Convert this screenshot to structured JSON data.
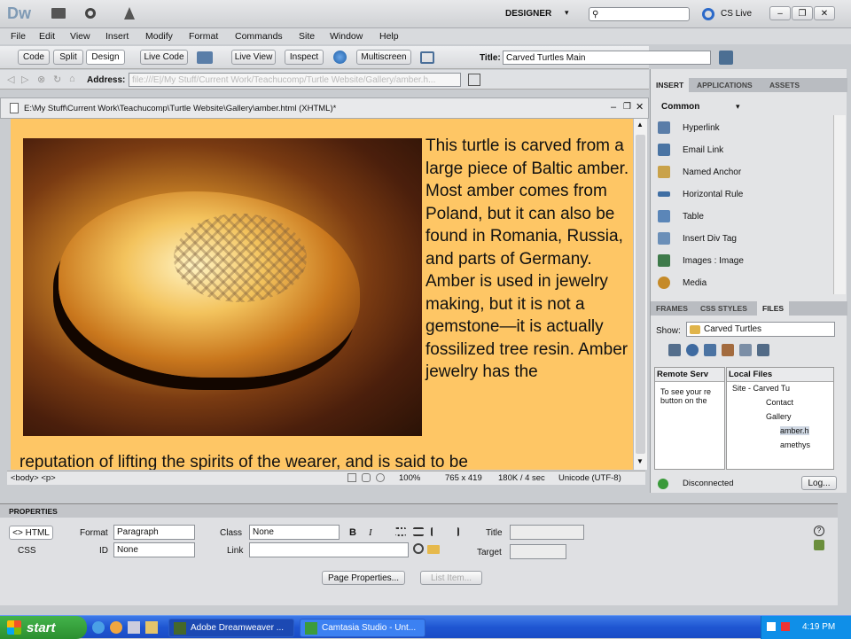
{
  "app": {
    "logo": "Dw",
    "workspace": "DESIGNER",
    "search_placeholder": "",
    "cs_live": "CS Live"
  },
  "menu": [
    "File",
    "Edit",
    "View",
    "Insert",
    "Modify",
    "Format",
    "Commands",
    "Site",
    "Window",
    "Help"
  ],
  "doc_toolbar": {
    "code": "Code",
    "split": "Split",
    "design": "Design",
    "live_code": "Live Code",
    "live_view": "Live View",
    "inspect": "Inspect",
    "multiscreen": "Multiscreen",
    "title_label": "Title:",
    "title_value": "Carved Turtles Main"
  },
  "browser_nav": {
    "address_label": "Address:",
    "address_value": "file:///E|/My Stuff/Current Work/Teachucomp/Turtle Website/Gallery/amber.h..."
  },
  "document": {
    "path": "E:\\My Stuff\\Current Work\\Teachucomp\\Turtle Website\\Gallery\\amber.html (XHTML)*",
    "text_column": "This turtle is carved from a large piece of Baltic amber.  Most amber comes from Poland, but it can also be found in Romania, Russia, and parts of Germany. Amber is used in jewelry making, but it is not a gemstone—it is actually fossilized tree resin.  Amber jewelry has the",
    "text_continued": "reputation of lifting the spirits of the wearer, and is said to be"
  },
  "status_bar": {
    "tags": "<body> <p>",
    "zoom": "100%",
    "dimensions": "765 x 419",
    "size": "180K / 4 sec",
    "encoding": "Unicode (UTF-8)"
  },
  "insert_panel": {
    "tabs": [
      "INSERT",
      "APPLICATIONS",
      "ASSETS"
    ],
    "category": "Common",
    "items": [
      "Hyperlink",
      "Email Link",
      "Named Anchor",
      "Horizontal Rule",
      "Table",
      "Insert Div Tag",
      "Images : Image",
      "Media"
    ]
  },
  "files_panel": {
    "tabs": [
      "FRAMES",
      "CSS STYLES",
      "FILES"
    ],
    "show_label": "Show:",
    "site": "Carved Turtles",
    "remote_header": "Remote Serv",
    "local_header": "Local Files",
    "remote_hint": "To see your re button on the",
    "tree": [
      "Site - Carved Tu",
      "Contact",
      "Gallery",
      "amber.h",
      "amethys"
    ],
    "status": "Disconnected",
    "log_button": "Log..."
  },
  "properties": {
    "header": "PROPERTIES",
    "html_btn": "<> HTML",
    "css_btn": "CSS",
    "format_label": "Format",
    "format_value": "Paragraph",
    "id_label": "ID",
    "id_value": "None",
    "class_label": "Class",
    "class_value": "None",
    "link_label": "Link",
    "title_label": "Title",
    "target_label": "Target",
    "bold": "B",
    "italic": "I",
    "page_properties": "Page Properties...",
    "list_item": "List Item..."
  },
  "taskbar": {
    "start": "start",
    "tasks": [
      "Adobe Dreamweaver ...",
      "Camtasia Studio - Unt..."
    ],
    "time": "4:19 PM"
  },
  "colors": {
    "page_bg": "#fec665",
    "taskbar": "#1f56d2",
    "start": "#2b8f2f"
  }
}
